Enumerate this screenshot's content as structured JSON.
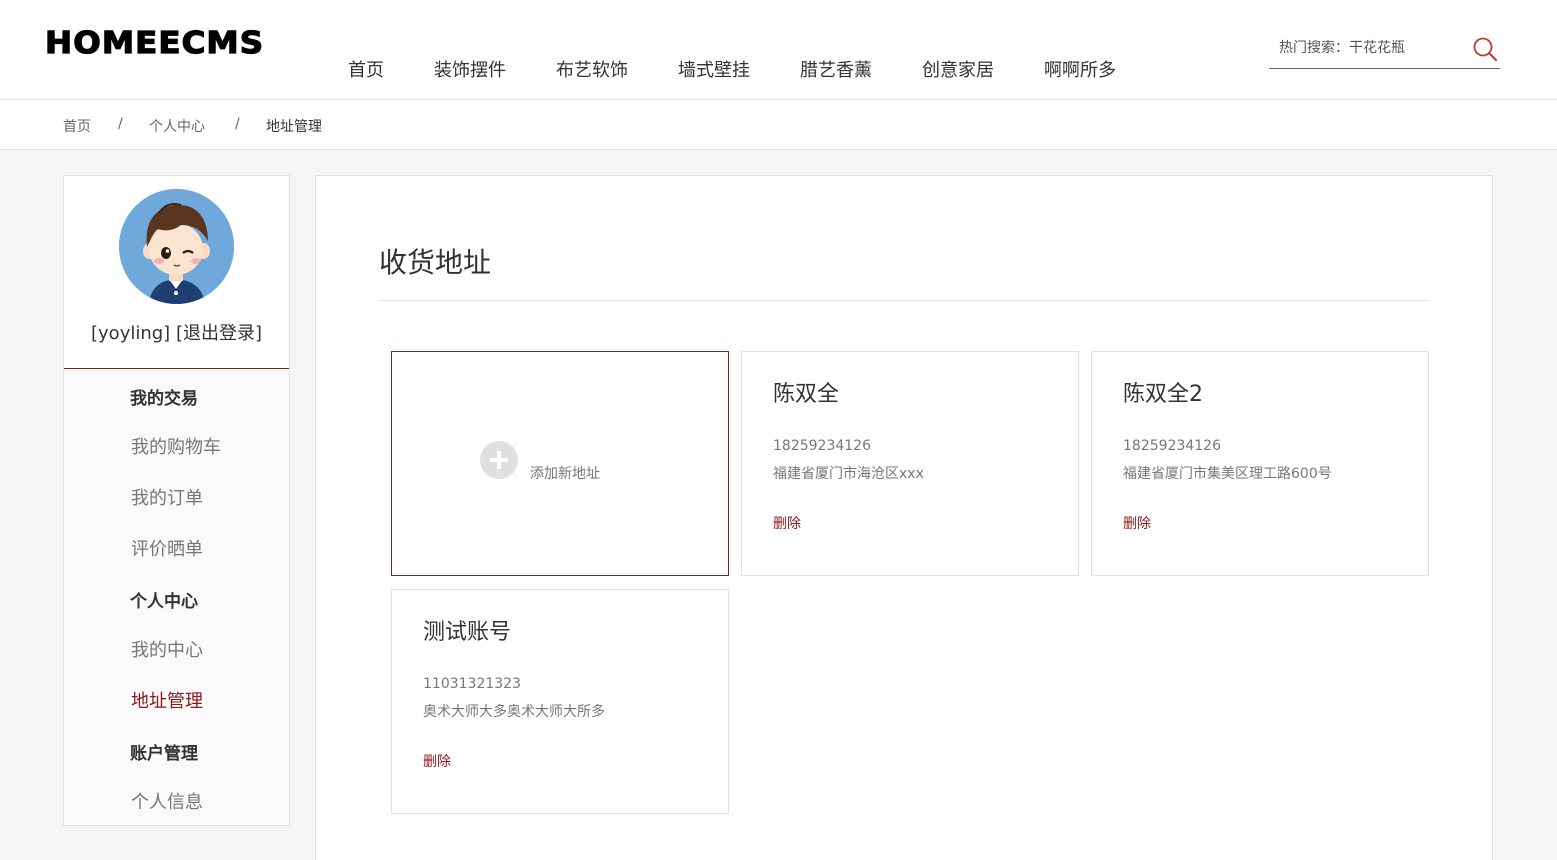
{
  "header": {
    "logo": "HOMEECMS",
    "nav": [
      "首页",
      "装饰摆件",
      "布艺软饰",
      "墙式壁挂",
      "腊艺香薰",
      "创意家居",
      "啊啊所多"
    ],
    "search_placeholder": "热门搜索：干花花瓶"
  },
  "breadcrumb": {
    "home": "首页",
    "sep": "/",
    "parent": "个人中心",
    "current": "地址管理"
  },
  "sidebar": {
    "username": "[yoyling]",
    "logout": "[退出登录]",
    "groups": {
      "trade": "我的交易",
      "personal": "个人中心",
      "account": "账户管理"
    },
    "items": {
      "cart": "我的购物车",
      "orders": "我的订单",
      "reviews": "评价晒单",
      "center": "我的中心",
      "address": "地址管理",
      "info": "个人信息"
    }
  },
  "main": {
    "title": "收货地址",
    "add_label": "添加新地址",
    "delete_label": "删除",
    "addresses": [
      {
        "name": "陈双全",
        "phone": "18259234126",
        "address": "福建省厦门市海沧区xxx"
      },
      {
        "name": "陈双全2",
        "phone": "18259234126",
        "address": "福建省厦门市集美区理工路600号"
      },
      {
        "name": "测试账号",
        "phone": "11031321323",
        "address": "奥术大师大多奥术大师大所多"
      }
    ]
  },
  "colors": {
    "accent": "#8b1a1a",
    "avatar_bg": "#6fa9db"
  }
}
